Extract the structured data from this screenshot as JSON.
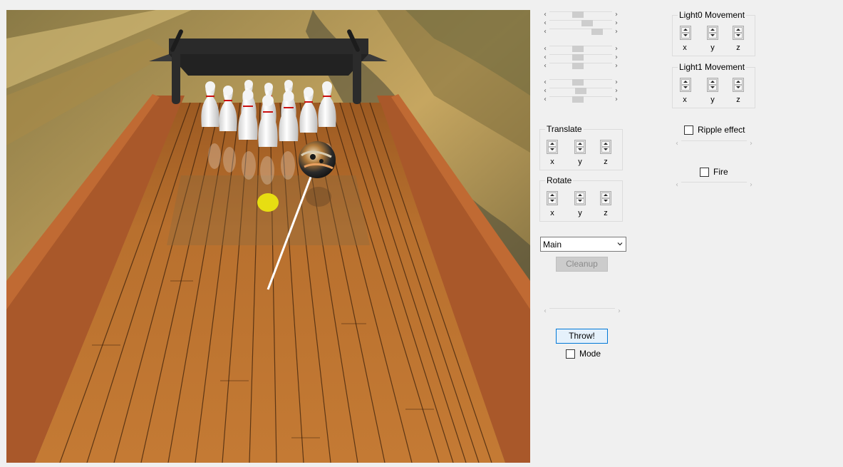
{
  "viewport": {
    "name": "bowling-lane-3d-view"
  },
  "camera_sliders": [
    {
      "group": 1,
      "thumb": 0.45
    },
    {
      "group": 1,
      "thumb": 0.62
    },
    {
      "group": 1,
      "thumb": 0.82
    },
    {
      "group": 2,
      "thumb": 0.45
    },
    {
      "group": 2,
      "thumb": 0.45
    },
    {
      "group": 2,
      "thumb": 0.45
    },
    {
      "group": 3,
      "thumb": 0.45
    },
    {
      "group": 3,
      "thumb": 0.5
    },
    {
      "group": 3,
      "thumb": 0.44
    }
  ],
  "translate": {
    "title": "Translate",
    "axes": [
      "x",
      "y",
      "z"
    ]
  },
  "rotate": {
    "title": "Rotate",
    "axes": [
      "x",
      "y",
      "z"
    ]
  },
  "light0": {
    "title": "Light0 Movement",
    "axes": [
      "x",
      "y",
      "z"
    ]
  },
  "light1": {
    "title": "Light1 Movement",
    "axes": [
      "x",
      "y",
      "z"
    ]
  },
  "ripple": {
    "label": "Ripple effect",
    "checked": false
  },
  "fire": {
    "label": "Fire",
    "checked": false
  },
  "select": {
    "value": "Main"
  },
  "buttons": {
    "cleanup": "Cleanup",
    "throw": "Throw!"
  },
  "mode": {
    "label": "Mode",
    "checked": false
  },
  "colors": {
    "lane_wood": "#b8702e",
    "gutter": "#a9582a",
    "pin_white": "#f2f2f2",
    "pin_stripe": "#cc1010",
    "aim_dot": "#e7de12",
    "accent_focus": "#0078d7"
  }
}
